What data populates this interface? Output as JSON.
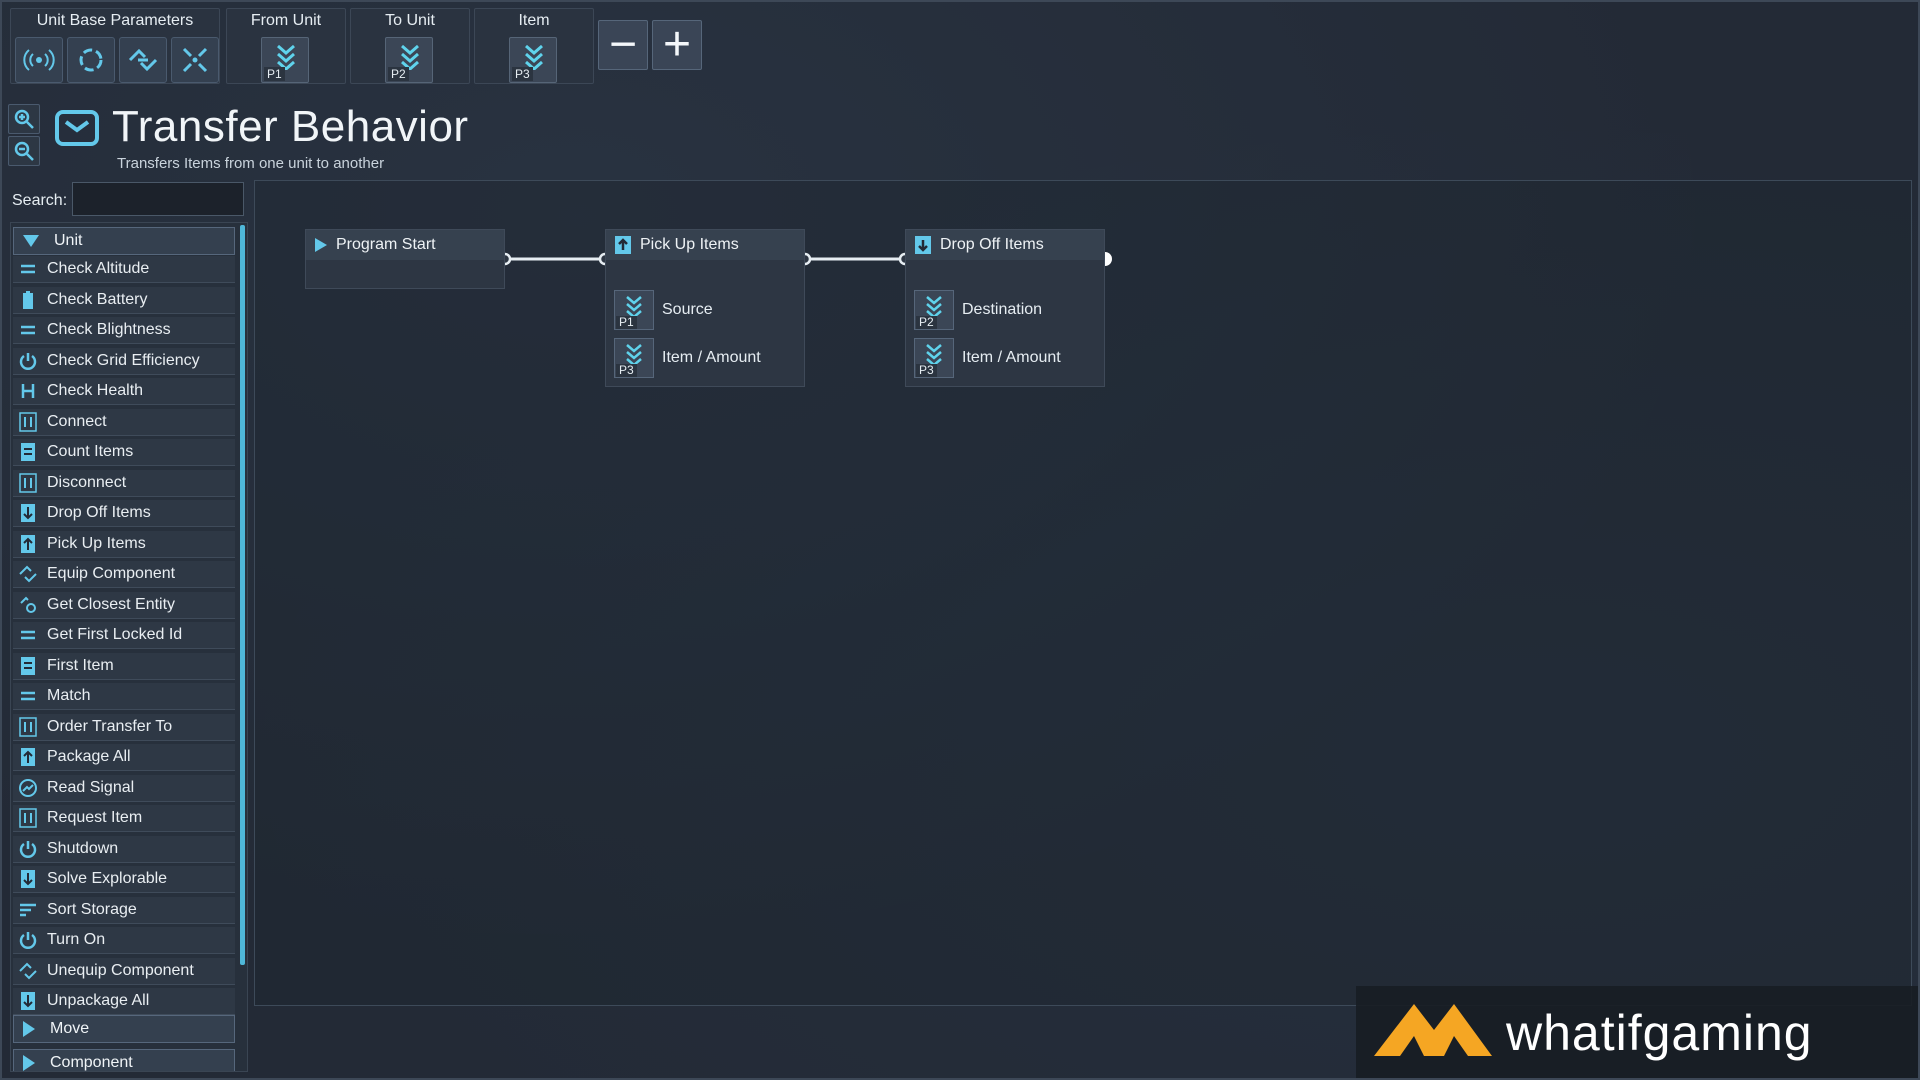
{
  "toolbar": {
    "base_label": "Unit Base Parameters",
    "base_icons": [
      "signal-icon",
      "cycle-icon",
      "link-icon",
      "compress-icon"
    ],
    "params": [
      {
        "label": "From Unit",
        "tag": "P1"
      },
      {
        "label": "To Unit",
        "tag": "P2"
      },
      {
        "label": "Item",
        "tag": "P3"
      }
    ],
    "zoom_out_label": "−",
    "zoom_in_label": "+"
  },
  "header": {
    "title": "Transfer Behavior",
    "subtitle": "Transfers Items from one unit to another"
  },
  "search": {
    "label": "Search:",
    "value": ""
  },
  "palette": {
    "category": "Unit",
    "items": [
      {
        "label": "Check Altitude",
        "icon": "equals-icon"
      },
      {
        "label": "Check Battery",
        "icon": "battery-icon"
      },
      {
        "label": "Check Blightness",
        "icon": "equals-icon"
      },
      {
        "label": "Check Grid Efficiency",
        "icon": "power-icon"
      },
      {
        "label": "Check Health",
        "icon": "health-icon"
      },
      {
        "label": "Connect",
        "icon": "connect-icon"
      },
      {
        "label": "Count Items",
        "icon": "count-icon"
      },
      {
        "label": "Disconnect",
        "icon": "connect-icon"
      },
      {
        "label": "Drop Off Items",
        "icon": "drop-off-icon"
      },
      {
        "label": "Pick Up Items",
        "icon": "pick-up-icon"
      },
      {
        "label": "Equip Component",
        "icon": "component-icon"
      },
      {
        "label": "Get Closest Entity",
        "icon": "entity-icon"
      },
      {
        "label": "Get First Locked Id",
        "icon": "equals-icon"
      },
      {
        "label": "First Item",
        "icon": "count-icon"
      },
      {
        "label": "Match",
        "icon": "equals-icon"
      },
      {
        "label": "Order Transfer To",
        "icon": "connect-icon"
      },
      {
        "label": "Package All",
        "icon": "pick-up-icon"
      },
      {
        "label": "Read Signal",
        "icon": "signal-icon"
      },
      {
        "label": "Request Item",
        "icon": "connect-icon"
      },
      {
        "label": "Shutdown",
        "icon": "power-icon"
      },
      {
        "label": "Solve Explorable",
        "icon": "drop-off-icon"
      },
      {
        "label": "Sort Storage",
        "icon": "sort-icon"
      },
      {
        "label": "Turn On",
        "icon": "power-icon"
      },
      {
        "label": "Unequip Component",
        "icon": "component-icon"
      },
      {
        "label": "Unpackage All",
        "icon": "drop-off-icon"
      }
    ],
    "next_category": "Move",
    "partial_category": "Component"
  },
  "nodes": {
    "start": {
      "title": "Program Start"
    },
    "pickup": {
      "title": "Pick Up Items",
      "rows": [
        {
          "label": "Source",
          "tag": "P1"
        },
        {
          "label": "Item / Amount",
          "tag": "P3"
        }
      ]
    },
    "dropoff": {
      "title": "Drop Off Items",
      "rows": [
        {
          "label": "Destination",
          "tag": "P2"
        },
        {
          "label": "Item / Amount",
          "tag": "P3"
        }
      ]
    }
  },
  "watermark": {
    "text": "whatifgaming"
  },
  "colors": {
    "accent": "#4fc3e8",
    "logo_orange": "#f5a623"
  }
}
